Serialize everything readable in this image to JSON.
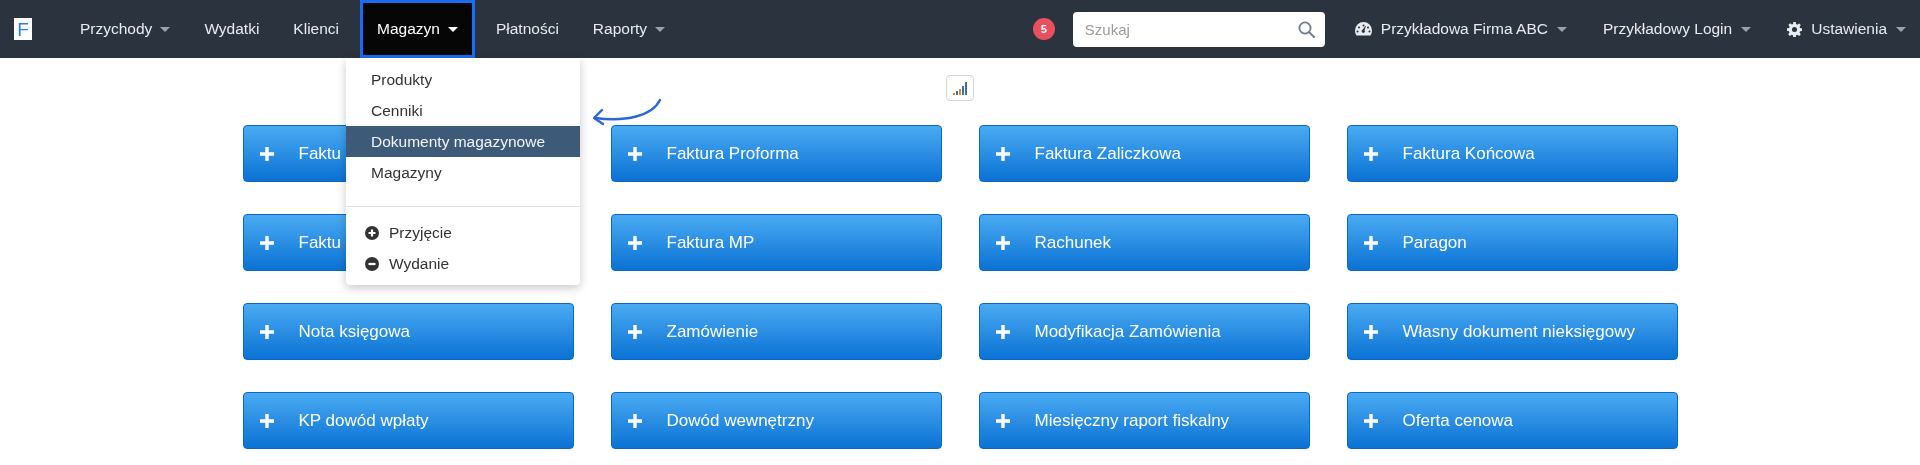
{
  "logo": {
    "letter": "F"
  },
  "nav": {
    "items": [
      {
        "label": "Przychody",
        "has_menu": true,
        "selected": false
      },
      {
        "label": "Wydatki",
        "has_menu": false,
        "selected": false
      },
      {
        "label": "Klienci",
        "has_menu": false,
        "selected": false
      },
      {
        "label": "Magazyn",
        "has_menu": true,
        "selected": true
      },
      {
        "label": "Płatności",
        "has_menu": false,
        "selected": false
      },
      {
        "label": "Raporty",
        "has_menu": true,
        "selected": false
      }
    ]
  },
  "notifications": {
    "count": "5"
  },
  "search": {
    "placeholder": "Szukaj"
  },
  "account_menus": [
    {
      "kind": "company",
      "label": "Przykładowa Firma ABC"
    },
    {
      "kind": "user",
      "label": "Przykładowy Login"
    },
    {
      "kind": "settings",
      "label": "Ustawienia"
    }
  ],
  "dropdown": {
    "sections": [
      {
        "items": [
          {
            "kind": "link",
            "label": "Produkty",
            "selected": false
          },
          {
            "kind": "link",
            "label": "Cenniki",
            "selected": false
          },
          {
            "kind": "link",
            "label": "Dokumenty magazynowe",
            "selected": true
          },
          {
            "kind": "link",
            "label": "Magazyny",
            "selected": false
          }
        ]
      },
      {
        "items": [
          {
            "kind": "add",
            "label": "Przyjęcie",
            "selected": false
          },
          {
            "kind": "remove",
            "label": "Wydanie",
            "selected": false
          }
        ]
      }
    ]
  },
  "documents": [
    {
      "label": "Faktu"
    },
    {
      "label": "Faktura Proforma"
    },
    {
      "label": "Faktura Zaliczkowa"
    },
    {
      "label": "Faktura Końcowa"
    },
    {
      "label": "Faktu"
    },
    {
      "label": "Faktura MP"
    },
    {
      "label": "Rachunek"
    },
    {
      "label": "Paragon"
    },
    {
      "label": "Nota księgowa"
    },
    {
      "label": "Zamówienie"
    },
    {
      "label": "Modyfikacja Zamówienia"
    },
    {
      "label": "Własny dokument nieksięgowy"
    },
    {
      "label": "KP dowód wpłaty"
    },
    {
      "label": "Dowód wewnętrzny"
    },
    {
      "label": "Miesięczny raport fiskalny"
    },
    {
      "label": "Oferta cenowa"
    }
  ]
}
